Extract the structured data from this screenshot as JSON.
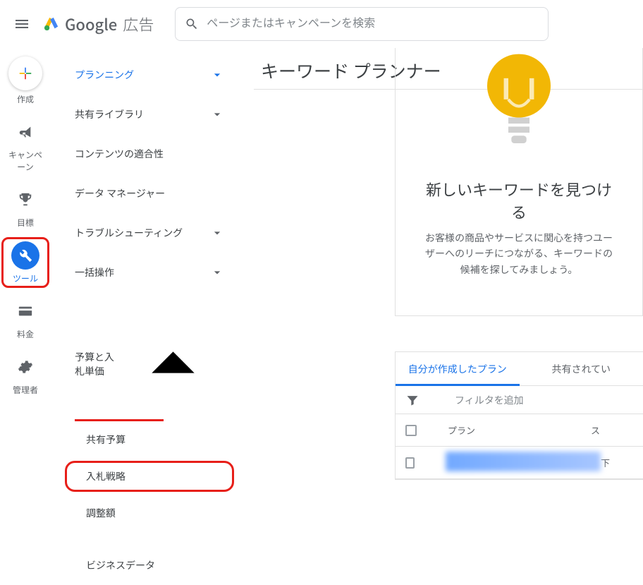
{
  "header": {
    "brand_google": "Google",
    "brand_ads": "広告",
    "search_placeholder": "ページまたはキャンペーンを検索"
  },
  "rail": {
    "create": "作成",
    "campaigns": "キャンペーン",
    "goals": "目標",
    "tools": "ツール",
    "billing": "料金",
    "admin": "管理者"
  },
  "menu": {
    "planning": "プランニング",
    "shared_library": "共有ライブラリ",
    "content_suitability": "コンテンツの適合性",
    "data_manager": "データ マネージャー",
    "troubleshooting": "トラブルシューティング",
    "bulk_actions": "一括操作",
    "bidding_header": "予算と入札単価",
    "shared_budget": "共有予算",
    "bid_strategy": "入札戦略",
    "adjustments": "調整額",
    "business_data": "ビジネスデータ"
  },
  "main": {
    "page_title": "キーワード プランナー",
    "find_title": "新しいキーワードを見つける",
    "find_body": "お客様の商品やサービスに関心を持つユーザーへのリーチにつながる、キーワードの候補を探してみましょう。",
    "tabs": {
      "created": "自分が作成したプラン",
      "shared": "共有されてい"
    },
    "filter_add": "フィルタを追加",
    "table": {
      "col_plan": "プラン",
      "col_status": "ス",
      "row1_status": "下"
    }
  }
}
